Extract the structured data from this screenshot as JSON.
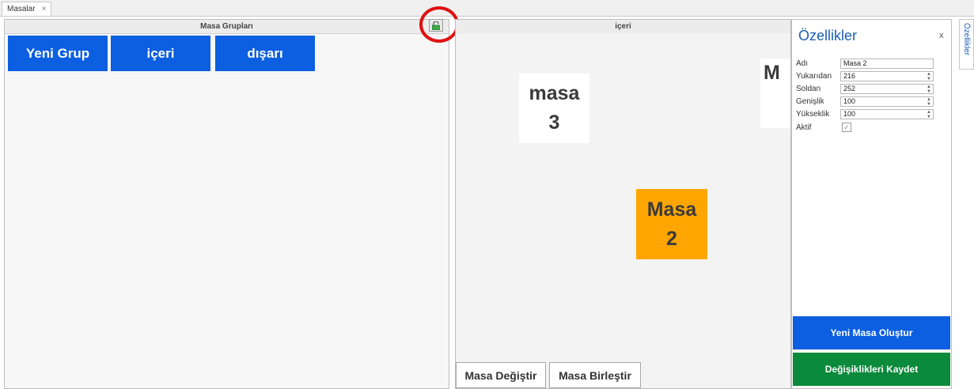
{
  "tab": {
    "label": "Masalar",
    "close": "×"
  },
  "groups_panel": {
    "header": "Masa Grupları",
    "buttons": [
      "Yeni Grup",
      "içeri",
      "dışarı"
    ]
  },
  "room_panel": {
    "header": "içeri",
    "tables": [
      {
        "line1": "masa",
        "line2": "3",
        "color": "#ffffff"
      },
      {
        "line1": "Masa",
        "line2": "2",
        "color": "#ffa500"
      },
      {
        "line1": "M",
        "line2": "",
        "color": "#ffffff"
      }
    ],
    "bottom_buttons": [
      "Masa Değiştir",
      "Masa Birleştir"
    ]
  },
  "properties": {
    "title": "Özellikler",
    "close": "x",
    "fields": [
      {
        "label": "Adı",
        "value": "Masa 2"
      },
      {
        "label": "Yukarıdan",
        "value": "216"
      },
      {
        "label": "Soldan",
        "value": "252"
      },
      {
        "label": "Genişlik",
        "value": "100"
      },
      {
        "label": "Yükseklik",
        "value": "100"
      }
    ],
    "active_label": "Aktif",
    "active_checked": true,
    "create_button": "Yeni Masa Oluştur",
    "save_button": "Değişiklikleri Kaydet"
  },
  "side_tab": {
    "label": "Özellikler"
  },
  "colors": {
    "blue": "#0b5fe0",
    "green": "#0a8a3a",
    "orange": "#ffa500",
    "circle": "#e01010"
  }
}
